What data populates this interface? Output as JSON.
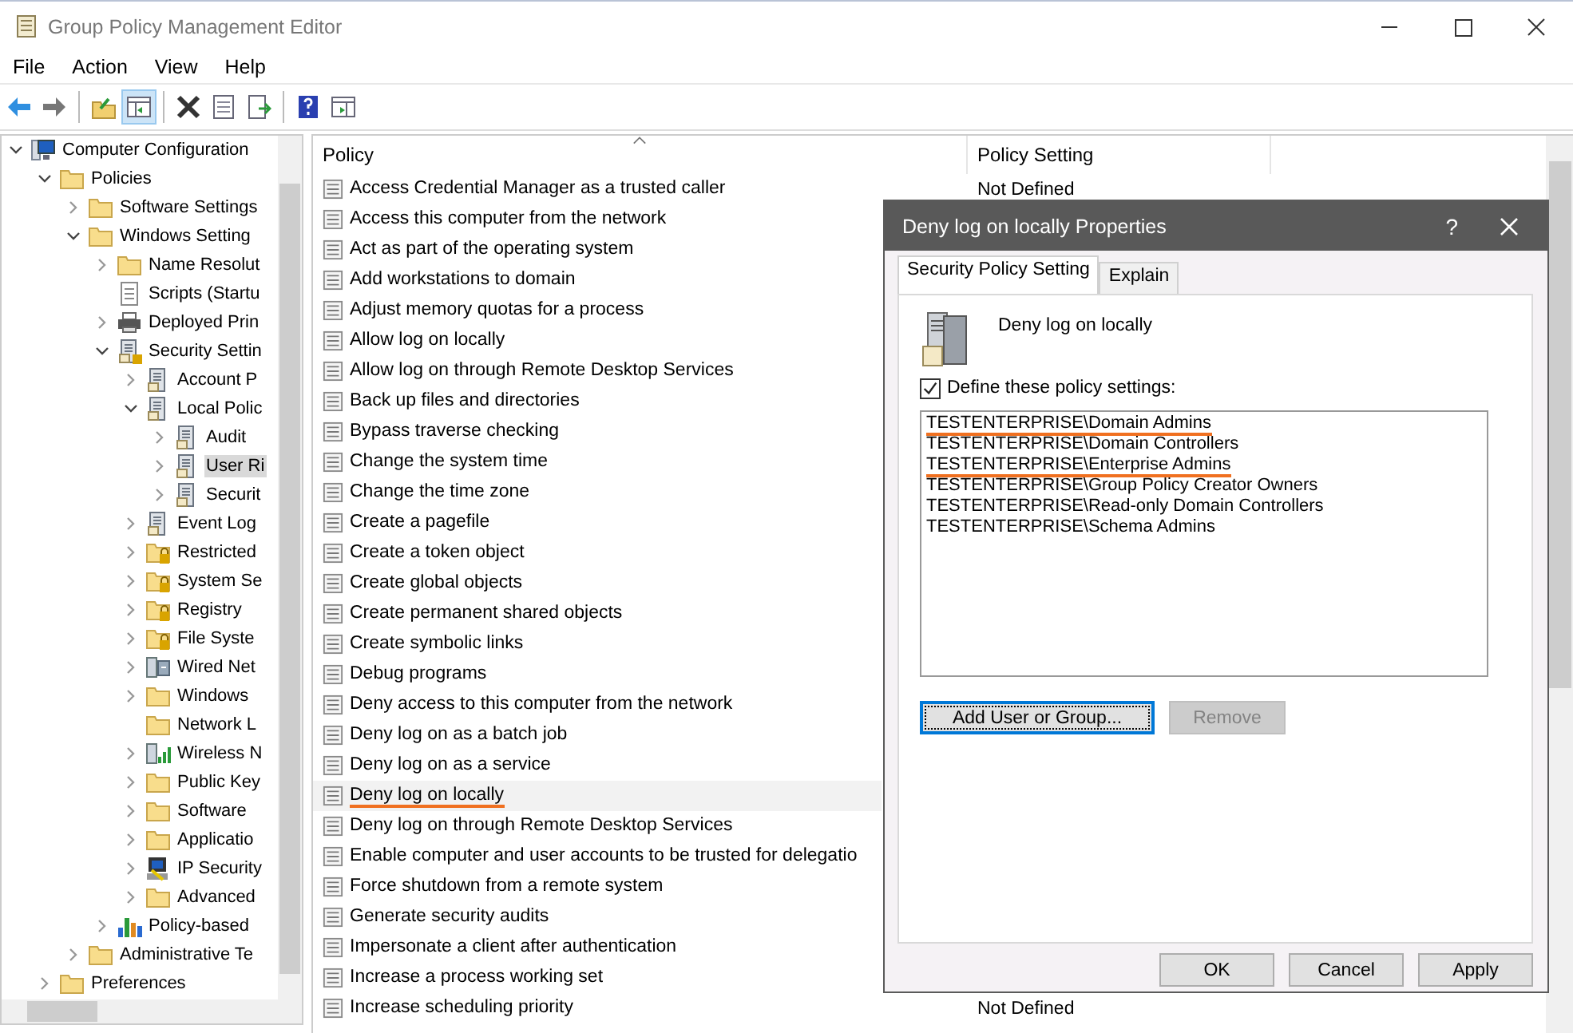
{
  "window": {
    "title": "Group Policy Management Editor"
  },
  "menu": [
    "File",
    "Action",
    "View",
    "Help"
  ],
  "toolbar": [
    {
      "kind": "back",
      "selected": false
    },
    {
      "kind": "forward",
      "selected": false
    },
    {
      "kind": "sep"
    },
    {
      "kind": "up",
      "selected": false
    },
    {
      "kind": "tree",
      "selected": true
    },
    {
      "kind": "sep"
    },
    {
      "kind": "delete",
      "selected": false
    },
    {
      "kind": "properties",
      "selected": false
    },
    {
      "kind": "export",
      "selected": false
    },
    {
      "kind": "sep"
    },
    {
      "kind": "help",
      "selected": false
    },
    {
      "kind": "pane",
      "selected": false
    }
  ],
  "tree": [
    {
      "label": "Computer Configuration",
      "kind": "computer",
      "expanded": true,
      "selected": false,
      "children": [
        {
          "label": "Policies",
          "kind": "folder",
          "expanded": true,
          "selected": false,
          "children": [
            {
              "label": "Software Settings",
              "kind": "folder",
              "expanded": false,
              "selected": false
            },
            {
              "label": "Windows Setting",
              "kind": "folder",
              "expanded": true,
              "selected": false,
              "children": [
                {
                  "label": "Name Resolut",
                  "kind": "folder",
                  "expanded": false,
                  "selected": false
                },
                {
                  "label": "Scripts (Startu",
                  "kind": "script",
                  "selected": false
                },
                {
                  "label": "Deployed Prin",
                  "kind": "printer",
                  "expanded": false,
                  "selected": false
                },
                {
                  "label": "Security Settin",
                  "kind": "lockserver",
                  "expanded": true,
                  "selected": false,
                  "children": [
                    {
                      "label": "Account P",
                      "kind": "server",
                      "expanded": false,
                      "selected": false
                    },
                    {
                      "label": "Local Polic",
                      "kind": "server",
                      "expanded": true,
                      "selected": false,
                      "children": [
                        {
                          "label": "Audit",
                          "kind": "server",
                          "expanded": false,
                          "selected": false
                        },
                        {
                          "label": "User Ri",
                          "kind": "server",
                          "expanded": false,
                          "selected": true
                        },
                        {
                          "label": "Securit",
                          "kind": "server",
                          "expanded": false,
                          "selected": false
                        }
                      ]
                    },
                    {
                      "label": "Event Log",
                      "kind": "server",
                      "expanded": false,
                      "selected": false
                    },
                    {
                      "label": "Restricted",
                      "kind": "lockfolder",
                      "expanded": false,
                      "selected": false
                    },
                    {
                      "label": "System Se",
                      "kind": "lockfolder",
                      "expanded": false,
                      "selected": false
                    },
                    {
                      "label": "Registry",
                      "kind": "lockfolder",
                      "expanded": false,
                      "selected": false
                    },
                    {
                      "label": "File Syste",
                      "kind": "lockfolder",
                      "expanded": false,
                      "selected": false
                    },
                    {
                      "label": "Wired Net",
                      "kind": "network",
                      "expanded": false,
                      "selected": false
                    },
                    {
                      "label": "Windows",
                      "kind": "folder",
                      "expanded": false,
                      "selected": false
                    },
                    {
                      "label": "Network L",
                      "kind": "folder",
                      "selected": false
                    },
                    {
                      "label": "Wireless N",
                      "kind": "wireless",
                      "expanded": false,
                      "selected": false
                    },
                    {
                      "label": "Public Key",
                      "kind": "folder",
                      "expanded": false,
                      "selected": false
                    },
                    {
                      "label": "Software",
                      "kind": "folder",
                      "expanded": false,
                      "selected": false
                    },
                    {
                      "label": "Applicatio",
                      "kind": "folder",
                      "expanded": false,
                      "selected": false
                    },
                    {
                      "label": "IP Security",
                      "kind": "ipsec",
                      "expanded": false,
                      "selected": false
                    },
                    {
                      "label": "Advanced",
                      "kind": "folder",
                      "expanded": false,
                      "selected": false
                    }
                  ]
                },
                {
                  "label": "Policy-based",
                  "kind": "chart",
                  "expanded": false,
                  "selected": false
                }
              ]
            },
            {
              "label": "Administrative Te",
              "kind": "folder",
              "expanded": false,
              "selected": false
            }
          ]
        },
        {
          "label": "Preferences",
          "kind": "folder",
          "expanded": false,
          "selected": false
        }
      ]
    }
  ],
  "table": {
    "columns": [
      "Policy",
      "Policy Setting"
    ],
    "rows": [
      {
        "policy": "Access Credential Manager as a trusted caller",
        "setting": "Not Defined",
        "selected": false,
        "underlined": false
      },
      {
        "policy": "Access this computer from the network",
        "selected": false,
        "underlined": false
      },
      {
        "policy": "Act as part of the operating system",
        "selected": false,
        "underlined": false
      },
      {
        "policy": "Add workstations to domain",
        "selected": false,
        "underlined": false
      },
      {
        "policy": "Adjust memory quotas for a process",
        "selected": false,
        "underlined": false
      },
      {
        "policy": "Allow log on locally",
        "selected": false,
        "underlined": false
      },
      {
        "policy": "Allow log on through Remote Desktop Services",
        "selected": false,
        "underlined": false
      },
      {
        "policy": "Back up files and directories",
        "selected": false,
        "underlined": false
      },
      {
        "policy": "Bypass traverse checking",
        "selected": false,
        "underlined": false
      },
      {
        "policy": "Change the system time",
        "selected": false,
        "underlined": false
      },
      {
        "policy": "Change the time zone",
        "selected": false,
        "underlined": false
      },
      {
        "policy": "Create a pagefile",
        "selected": false,
        "underlined": false
      },
      {
        "policy": "Create a token object",
        "selected": false,
        "underlined": false
      },
      {
        "policy": "Create global objects",
        "selected": false,
        "underlined": false
      },
      {
        "policy": "Create permanent shared objects",
        "selected": false,
        "underlined": false
      },
      {
        "policy": "Create symbolic links",
        "selected": false,
        "underlined": false
      },
      {
        "policy": "Debug programs",
        "selected": false,
        "underlined": false
      },
      {
        "policy": "Deny access to this computer from the network",
        "selected": false,
        "underlined": false
      },
      {
        "policy": "Deny log on as a batch job",
        "selected": false,
        "underlined": false
      },
      {
        "policy": "Deny log on as a service",
        "selected": false,
        "underlined": false
      },
      {
        "policy": "Deny log on locally",
        "selected": true,
        "underlined": true
      },
      {
        "policy": "Deny log on through Remote Desktop Services",
        "selected": false,
        "underlined": false
      },
      {
        "policy": "Enable computer and user accounts to be trusted for delegatio",
        "selected": false,
        "underlined": false
      },
      {
        "policy": "Force shutdown from a remote system",
        "selected": false,
        "underlined": false
      },
      {
        "policy": "Generate security audits",
        "selected": false,
        "underlined": false
      },
      {
        "policy": "Impersonate a client after authentication",
        "selected": false,
        "underlined": false
      },
      {
        "policy": "Increase a process working set",
        "selected": false,
        "underlined": false
      },
      {
        "policy": "Increase scheduling priority",
        "setting": "Not Defined",
        "selected": false,
        "underlined": false
      }
    ]
  },
  "dialog": {
    "title": "Deny log on locally Properties",
    "help": "?",
    "tabs": [
      {
        "label": "Security Policy Setting",
        "selected": true
      },
      {
        "label": "Explain",
        "selected": false
      }
    ],
    "policy_name": "Deny log on locally",
    "define": {
      "label": "Define these policy settings:",
      "checked": true
    },
    "users": [
      {
        "name": "TESTENTERPRISE\\Domain Admins",
        "underlined": true
      },
      {
        "name": "TESTENTERPRISE\\Domain Controllers",
        "underlined": false
      },
      {
        "name": "TESTENTERPRISE\\Enterprise Admins",
        "underlined": true
      },
      {
        "name": "TESTENTERPRISE\\Group Policy Creator Owners",
        "underlined": false
      },
      {
        "name": "TESTENTERPRISE\\Read-only Domain Controllers",
        "underlined": false
      },
      {
        "name": "TESTENTERPRISE\\Schema Admins",
        "underlined": false
      }
    ],
    "buttons": [
      {
        "label": "Add User or Group...",
        "disabled": false,
        "kind": "list"
      },
      {
        "label": "Remove",
        "disabled": true,
        "kind": "list"
      },
      {
        "label": "OK",
        "disabled": false,
        "kind": "footer"
      },
      {
        "label": "Cancel",
        "disabled": false,
        "kind": "footer"
      },
      {
        "label": "Apply",
        "disabled": false,
        "kind": "footer"
      }
    ]
  }
}
